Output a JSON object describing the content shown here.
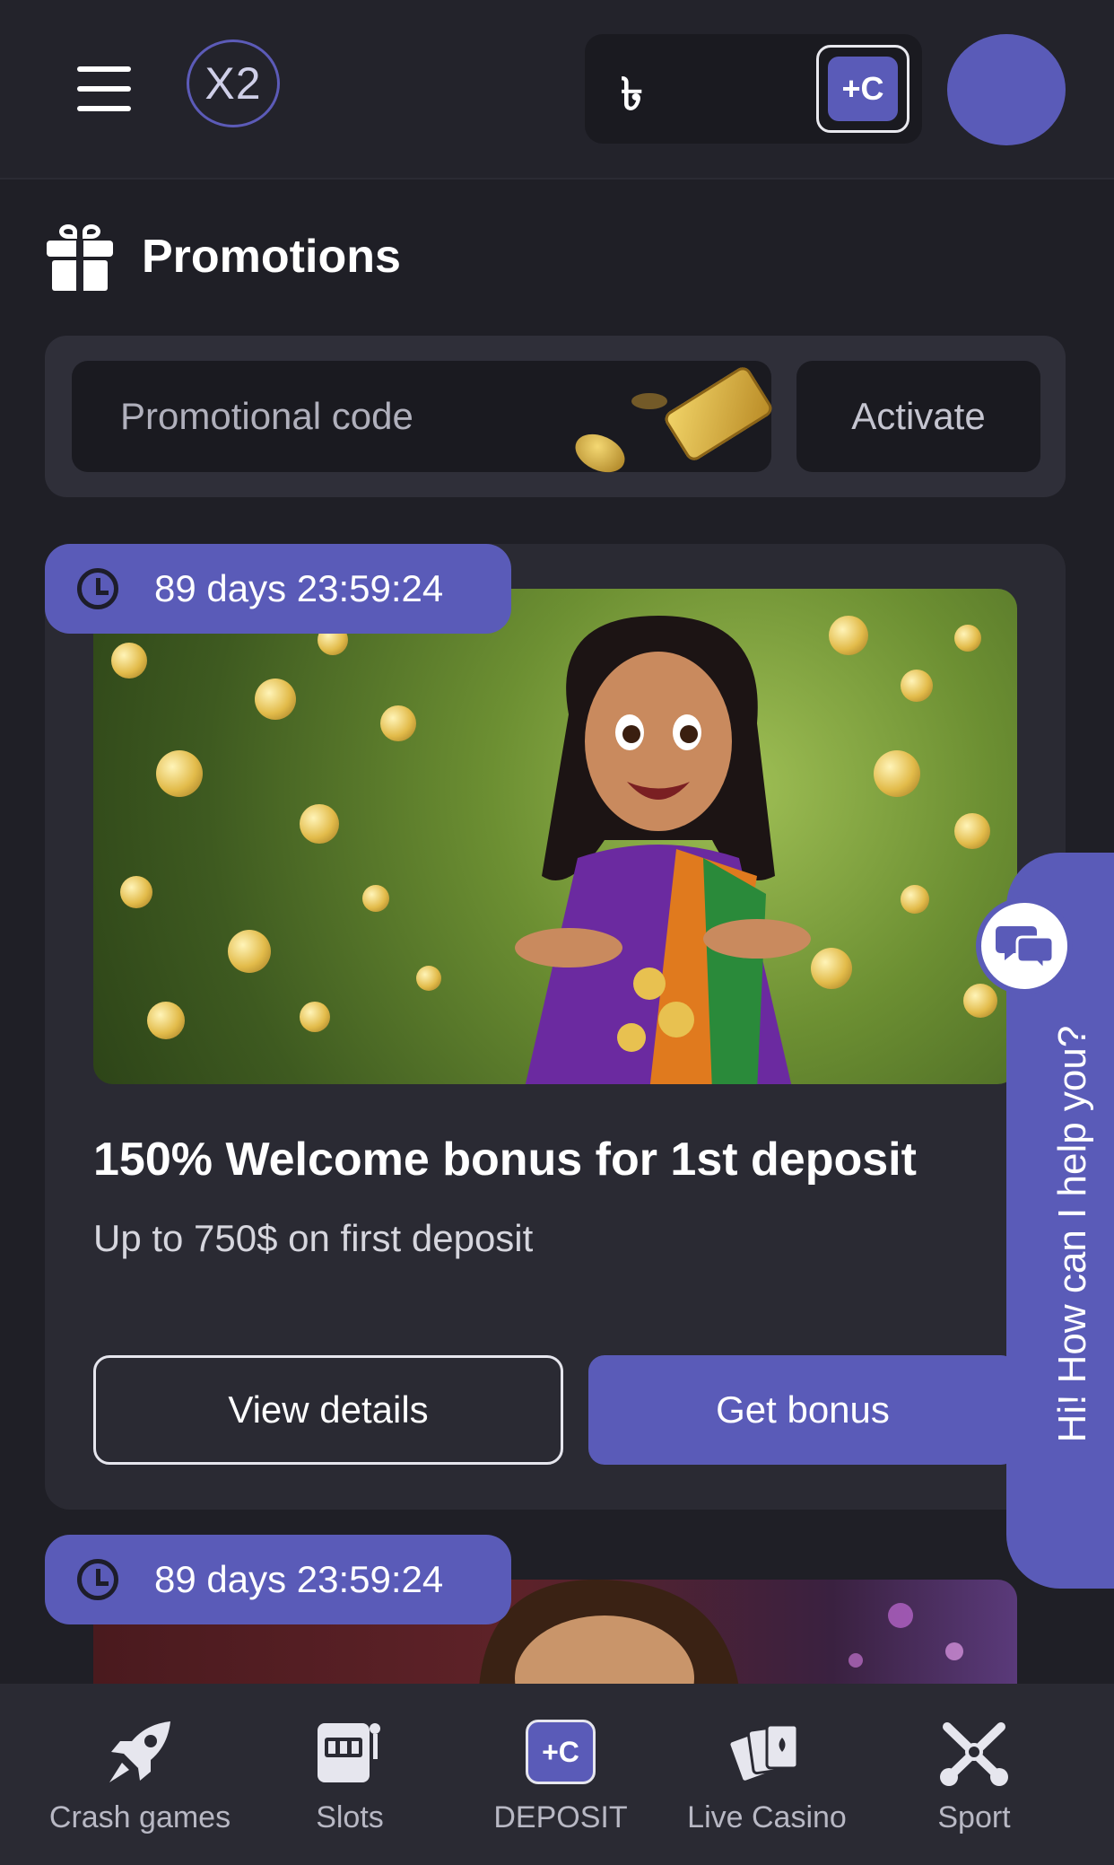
{
  "header": {
    "logo_text": "X2",
    "currency_symbol": "৳",
    "wallet_add_label": "+C"
  },
  "promotions": {
    "title": "Promotions",
    "code_placeholder": "Promotional code",
    "activate_label": "Activate"
  },
  "cards": [
    {
      "timer": "89 days 23:59:24",
      "title": "150% Welcome bonus for 1st deposit",
      "subtitle": "Up to 750$ on first deposit",
      "view_label": "View details",
      "bonus_label": "Get bonus"
    },
    {
      "timer": "89 days 23:59:24"
    }
  ],
  "help": {
    "text": "Hi! How can I help you?"
  },
  "bottom_nav": [
    {
      "label": "Crash games",
      "icon": "rocket-icon"
    },
    {
      "label": "Slots",
      "icon": "slot-machine-icon"
    },
    {
      "label": "DEPOSIT",
      "icon": "deposit-icon"
    },
    {
      "label": "Live Casino",
      "icon": "cards-icon"
    },
    {
      "label": "Sport",
      "icon": "sport-icon"
    }
  ],
  "colors": {
    "accent": "#5a5bb8",
    "background": "#1f1f26",
    "card": "#2a2a33"
  }
}
